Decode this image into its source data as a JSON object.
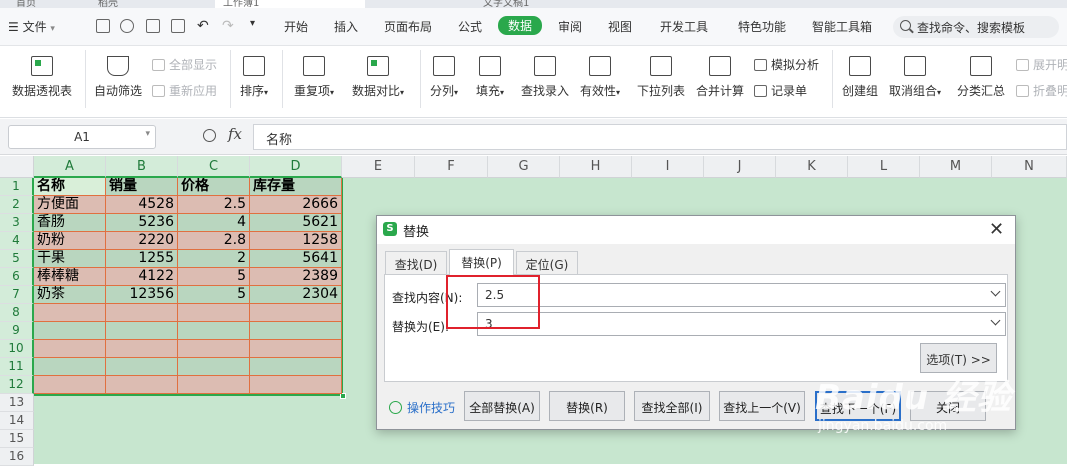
{
  "window_tabs": [
    {
      "label": "首页"
    },
    {
      "label": "稻壳"
    },
    {
      "label": "工作簿1"
    },
    {
      "label": "文字文稿1"
    }
  ],
  "menu": {
    "file_label": "文件",
    "items": [
      "开始",
      "插入",
      "页面布局",
      "公式",
      "数据",
      "审阅",
      "视图",
      "开发工具",
      "特色功能",
      "智能工具箱"
    ],
    "active": "数据",
    "search_placeholder": "查找命令、搜索模板"
  },
  "ribbon": {
    "pivot": "数据透视表",
    "autofilter": "自动筛选",
    "show_all": "全部显示",
    "reapply": "重新应用",
    "sort": "排序",
    "duplicates": "重复项",
    "compare": "数据对比",
    "split": "分列",
    "fill": "填充",
    "lookup_entry": "查找录入",
    "validity": "有效性",
    "dropdown_list": "下拉列表",
    "consolidate": "合并计算",
    "simulation": "模拟分析",
    "record_form": "记录单",
    "create_group": "创建组",
    "ungroup": "取消组合",
    "subtotal": "分类汇总",
    "expand": "展开明",
    "collapse": "折叠明"
  },
  "formula_bar": {
    "cell_ref": "A1",
    "fx": "fx",
    "value": "名称"
  },
  "sheet": {
    "columns": [
      "A",
      "B",
      "C",
      "D",
      "E",
      "F",
      "G",
      "H",
      "I",
      "J",
      "K",
      "L",
      "M",
      "N"
    ],
    "rows": [
      "1",
      "2",
      "3",
      "4",
      "5",
      "6",
      "7",
      "8",
      "9",
      "10",
      "11",
      "12",
      "13",
      "14",
      "15",
      "16"
    ],
    "header": [
      "名称",
      "销量",
      "价格",
      "库存量"
    ],
    "data": [
      [
        "方便面",
        "4528",
        "2.5",
        "2666"
      ],
      [
        "香肠",
        "5236",
        "4",
        "5621"
      ],
      [
        "奶粉",
        "2220",
        "2.8",
        "1258"
      ],
      [
        "干果",
        "1255",
        "2",
        "5641"
      ],
      [
        "棒棒糖",
        "4122",
        "5",
        "2389"
      ],
      [
        "奶茶",
        "12356",
        "5",
        "2304"
      ]
    ]
  },
  "dialog": {
    "title": "替换",
    "tabs": [
      "查找(D)",
      "替换(P)",
      "定位(G)"
    ],
    "active_tab": "替换(P)",
    "find_label": "查找内容(N):",
    "find_value": "2.5",
    "replace_label": "替换为(E):",
    "replace_value": "3",
    "options_button": "选项(T) >>",
    "tips_link": "操作技巧",
    "buttons": [
      "全部替换(A)",
      "替换(R)",
      "查找全部(I)",
      "查找上一个(V)",
      "查找下一个(F)",
      "关闭"
    ]
  },
  "watermark": {
    "main": "Baidu 经验",
    "sub": "jingyan.baidu.com"
  },
  "colors": {
    "accent_green": "#2aa84c",
    "sheet_bg": "#c7e6cf",
    "highlight_red": "#e0212c",
    "cell_border": "#e07040"
  }
}
